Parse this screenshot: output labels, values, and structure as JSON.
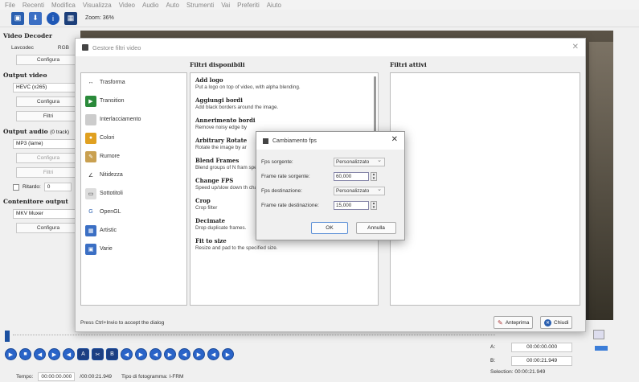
{
  "menu": [
    "File",
    "Recenti",
    "Modifica",
    "Visualizza",
    "Video",
    "Audio",
    "Auto",
    "Strumenti",
    "Vai",
    "Preferiti",
    "Aiuto"
  ],
  "toolbar": {
    "zoom": "Zoom: 36%"
  },
  "left": {
    "video_decoder": "Video Decoder",
    "lavcodec": "Lavcodec",
    "rgb": "RGB",
    "configura": "Configura",
    "output_video": "Output video",
    "video_codec": "HEVC (x265)",
    "filtri": "Filtri",
    "output_audio": "Output audio",
    "audio_tracks": "(0 track)",
    "audio_codec": "MP3 (lame)",
    "ritardo": "Ritardo:",
    "ritardo_val": "0",
    "contenitore": "Contenitore output",
    "muxer": "MKV Muxer"
  },
  "dialog": {
    "title": "Gestore filtri video",
    "available_header": "Filtri disponibili",
    "active_header": "Filtri attivi",
    "categories": [
      {
        "label": "Trasforma",
        "icon": "transform-icon"
      },
      {
        "label": "Transition",
        "icon": "transition-icon"
      },
      {
        "label": "Interlacciamento",
        "icon": "interlace-icon"
      },
      {
        "label": "Colori",
        "icon": "colors-icon"
      },
      {
        "label": "Rumore",
        "icon": "noise-icon"
      },
      {
        "label": "Nitidezza",
        "icon": "sharpness-icon"
      },
      {
        "label": "Sottotitoli",
        "icon": "subtitles-icon"
      },
      {
        "label": "OpenGL",
        "icon": "opengl-icon"
      },
      {
        "label": "Artistic",
        "icon": "artistic-icon"
      },
      {
        "label": "Varie",
        "icon": "misc-icon"
      }
    ],
    "filters": [
      {
        "name": "Add logo",
        "desc": "Put a logo on top of video, with alpha blending."
      },
      {
        "name": "Aggiungi bordi",
        "desc": "Add black borders around the image."
      },
      {
        "name": "Annerimento bordi",
        "desc": "Remove noisy edge by"
      },
      {
        "name": "Arbitrary Rotate",
        "desc": "Rotate the image by ar"
      },
      {
        "name": "Blend Frames",
        "desc": "Blend groups of N fram speeding up slow motio"
      },
      {
        "name": "Change FPS",
        "desc": "Speed up/slow down th changes duration."
      },
      {
        "name": "Crop",
        "desc": "Crop filter"
      },
      {
        "name": "Decimate",
        "desc": "Drop duplicate frames."
      },
      {
        "name": "Fit to size",
        "desc": "Resize and pad to the specified size."
      }
    ],
    "hint": "Press Ctrl+Invio to accept the dialog",
    "preview_btn": "Anteprima",
    "close_btn": "Chiudi"
  },
  "fps": {
    "title": "Cambiamento fps",
    "source_label": "Fps sorgente:",
    "source_value": "Personalizzato",
    "source_rate_label": "Frame rate sorgente:",
    "source_rate_value": "60,000",
    "dest_label": "Fps destinazione:",
    "dest_value": "Personalizzato",
    "dest_rate_label": "Frame rate destinazione:",
    "dest_rate_value": "15,000",
    "ok": "OK",
    "cancel": "Annulla"
  },
  "status": {
    "tempo_label": "Tempo:",
    "time_current": "00:00:00.000",
    "time_total": "/00:00:21.949",
    "frame_type": "Tipo di fotogramma: I-FRM"
  },
  "ab": {
    "a_label": "A:",
    "a_value": "00:00:00.000",
    "b_label": "B:",
    "b_value": "00:00:21.949",
    "selection": "Selection: 00:00:21.949"
  }
}
